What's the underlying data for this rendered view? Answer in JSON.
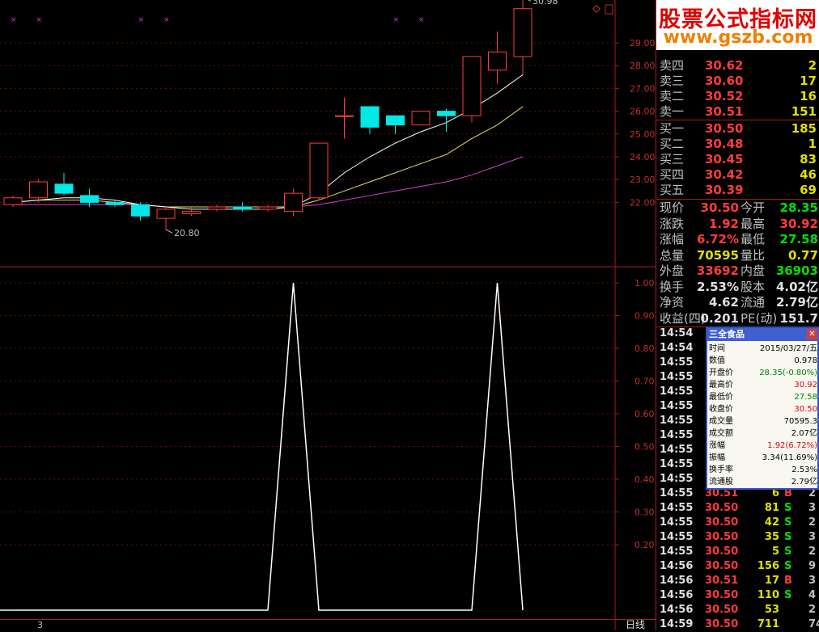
{
  "chart_data": [
    {
      "type": "candlestick",
      "y_ticks": [
        "29.00",
        "28.00",
        "27.00",
        "26.00",
        "25.00",
        "24.00",
        "23.00",
        "22.00"
      ],
      "ylim": [
        21.0,
        31.0
      ],
      "annotations": {
        "high": "30.98",
        "low": "20.80"
      },
      "candles": [
        {
          "o": 21.9,
          "c": 22.2,
          "h": 22.3,
          "l": 21.8
        },
        {
          "o": 22.2,
          "c": 22.9,
          "h": 23.0,
          "l": 22.0
        },
        {
          "o": 22.8,
          "c": 22.4,
          "h": 23.3,
          "l": 22.3
        },
        {
          "o": 22.3,
          "c": 22.0,
          "h": 22.6,
          "l": 21.8
        },
        {
          "o": 22.0,
          "c": 21.9,
          "h": 22.1,
          "l": 21.8
        },
        {
          "o": 21.9,
          "c": 21.4,
          "h": 22.0,
          "l": 21.2
        },
        {
          "o": 21.3,
          "c": 21.7,
          "h": 21.8,
          "l": 20.8
        },
        {
          "o": 21.5,
          "c": 21.6,
          "h": 21.8,
          "l": 21.4
        },
        {
          "o": 21.7,
          "c": 21.8,
          "h": 21.9,
          "l": 21.6
        },
        {
          "o": 21.8,
          "c": 21.7,
          "h": 22.0,
          "l": 21.6
        },
        {
          "o": 21.7,
          "c": 21.8,
          "h": 21.9,
          "l": 21.6
        },
        {
          "o": 21.6,
          "c": 22.4,
          "h": 22.6,
          "l": 21.4
        },
        {
          "o": 22.2,
          "c": 24.6,
          "h": 24.6,
          "l": 22.1
        },
        {
          "o": 25.8,
          "c": 25.8,
          "h": 26.6,
          "l": 24.8
        },
        {
          "o": 26.2,
          "c": 25.3,
          "h": 26.2,
          "l": 25.0
        },
        {
          "o": 25.8,
          "c": 25.4,
          "h": 25.8,
          "l": 25.0
        },
        {
          "o": 25.4,
          "c": 26.0,
          "h": 26.0,
          "l": 25.4
        },
        {
          "o": 26.0,
          "c": 25.8,
          "h": 26.1,
          "l": 25.1
        },
        {
          "o": 25.8,
          "c": 28.4,
          "h": 28.4,
          "l": 25.5
        },
        {
          "o": 27.8,
          "c": 28.6,
          "h": 29.5,
          "l": 27.2
        },
        {
          "o": 28.4,
          "c": 30.5,
          "h": 30.98,
          "l": 27.6
        }
      ],
      "ma_fast": [
        22.0,
        22.1,
        22.2,
        22.2,
        22.1,
        21.9,
        21.8,
        21.7,
        21.7,
        21.7,
        21.7,
        21.8,
        22.4,
        23.3,
        24.0,
        24.6,
        25.1,
        25.5,
        26.1,
        26.8,
        27.6
      ],
      "ma_mid": [
        22.0,
        22.1,
        22.1,
        22.1,
        22.0,
        21.9,
        21.8,
        21.8,
        21.8,
        21.8,
        21.8,
        21.8,
        22.1,
        22.5,
        22.9,
        23.3,
        23.7,
        24.1,
        24.8,
        25.4,
        26.2
      ],
      "ma_slow": [
        21.9,
        21.9,
        21.9,
        21.9,
        21.9,
        21.9,
        21.8,
        21.8,
        21.8,
        21.8,
        21.8,
        21.8,
        21.9,
        22.1,
        22.3,
        22.5,
        22.7,
        22.9,
        23.2,
        23.6,
        24.0
      ]
    },
    {
      "type": "line",
      "y_ticks": [
        "1.00",
        "0.90",
        "0.80",
        "0.70",
        "0.60",
        "0.50",
        "0.40",
        "0.30",
        "0.20"
      ],
      "ylim": [
        0.0,
        1.0
      ],
      "values": [
        0,
        0,
        0,
        0,
        0,
        0,
        0,
        0,
        0,
        0,
        0,
        1,
        0,
        0,
        0,
        0,
        0,
        0,
        0,
        1,
        0
      ]
    }
  ],
  "quotes": {
    "asks": [
      {
        "label": "卖四",
        "price": "30.62",
        "vol": "2"
      },
      {
        "label": "卖三",
        "price": "30.60",
        "vol": "17"
      },
      {
        "label": "卖二",
        "price": "30.52",
        "vol": "16"
      },
      {
        "label": "卖一",
        "price": "30.51",
        "vol": "151"
      }
    ],
    "bids": [
      {
        "label": "买一",
        "price": "30.50",
        "vol": "185"
      },
      {
        "label": "买二",
        "price": "30.48",
        "vol": "1"
      },
      {
        "label": "买三",
        "price": "30.45",
        "vol": "83"
      },
      {
        "label": "买四",
        "price": "30.42",
        "vol": "46"
      },
      {
        "label": "买五",
        "price": "30.39",
        "vol": "69"
      }
    ]
  },
  "stats": [
    {
      "l1": "现价",
      "v1": "30.50",
      "l2": "今开",
      "v2": "28.35"
    },
    {
      "l1": "涨跌",
      "v1": "1.92",
      "l2": "最高",
      "v2": "30.92"
    },
    {
      "l1": "涨幅",
      "v1": "6.72%",
      "l2": "最低",
      "v2": "27.58"
    },
    {
      "l1": "总量",
      "v1": "70595",
      "l2": "量比",
      "v2": "0.77"
    },
    {
      "l1": "外盘",
      "v1": "33692",
      "l2": "内盘",
      "v2": "36903"
    },
    {
      "l1": "换手",
      "v1": "2.53%",
      "l2": "股本",
      "v2": "4.02亿"
    },
    {
      "l1": "净资",
      "v1": "4.62",
      "l2": "流通",
      "v2": "2.79亿"
    },
    {
      "l1": "收益(四)",
      "v1": "0.201",
      "l2": "PE(动)",
      "v2": "151.7"
    }
  ],
  "ticks": [
    {
      "time": "14:54",
      "price": "",
      "vol": "",
      "bs": "",
      "n": ""
    },
    {
      "time": "14:54",
      "price": "",
      "vol": "",
      "bs": "",
      "n": ""
    },
    {
      "time": "14:55",
      "price": "",
      "vol": "",
      "bs": "",
      "n": ""
    },
    {
      "time": "14:55",
      "price": "",
      "vol": "",
      "bs": "",
      "n": ""
    },
    {
      "time": "14:55",
      "price": "",
      "vol": "",
      "bs": "",
      "n": ""
    },
    {
      "time": "14:55",
      "price": "",
      "vol": "",
      "bs": "",
      "n": ""
    },
    {
      "time": "14:55",
      "price": "",
      "vol": "",
      "bs": "",
      "n": ""
    },
    {
      "time": "14:55",
      "price": "",
      "vol": "",
      "bs": "",
      "n": ""
    },
    {
      "time": "14:55",
      "price": "",
      "vol": "",
      "bs": "",
      "n": ""
    },
    {
      "time": "14:55",
      "price": "",
      "vol": "",
      "bs": "",
      "n": ""
    },
    {
      "time": "14:55",
      "price": "",
      "vol": "",
      "bs": "",
      "n": ""
    },
    {
      "time": "14:55",
      "price": "30.51",
      "vol": "6",
      "bs": "B",
      "n": "2"
    },
    {
      "time": "14:55",
      "price": "30.50",
      "vol": "81",
      "bs": "S",
      "n": "3"
    },
    {
      "time": "14:55",
      "price": "30.50",
      "vol": "42",
      "bs": "S",
      "n": "2"
    },
    {
      "time": "14:55",
      "price": "30.50",
      "vol": "35",
      "bs": "S",
      "n": "3"
    },
    {
      "time": "14:55",
      "price": "30.50",
      "vol": "5",
      "bs": "S",
      "n": "2"
    },
    {
      "time": "14:56",
      "price": "30.50",
      "vol": "156",
      "bs": "S",
      "n": "9"
    },
    {
      "time": "14:56",
      "price": "30.51",
      "vol": "17",
      "bs": "B",
      "n": "3"
    },
    {
      "time": "14:56",
      "price": "30.50",
      "vol": "110",
      "bs": "S",
      "n": "4"
    },
    {
      "time": "14:56",
      "price": "30.50",
      "vol": "53",
      "bs": "",
      "n": "2"
    },
    {
      "time": "14:59",
      "price": "30.50",
      "vol": "711",
      "bs": "",
      "n": "74"
    }
  ],
  "popup": {
    "title": "三全食品",
    "close": "✕",
    "rows": [
      {
        "k": "时间",
        "v": "2015/03/27/五",
        "c": "#000000"
      },
      {
        "k": "数值",
        "v": "0.978",
        "c": "#000000"
      },
      {
        "k": "开盘价",
        "v": "28.35(-0.80%)",
        "c": "#008000"
      },
      {
        "k": "最高价",
        "v": "30.92",
        "c": "#e00000"
      },
      {
        "k": "最低价",
        "v": "27.58",
        "c": "#008000"
      },
      {
        "k": "收盘价",
        "v": "30.50",
        "c": "#e00000"
      },
      {
        "k": "成交量",
        "v": "70595.3",
        "c": "#000000"
      },
      {
        "k": "成交额",
        "v": "2.07亿",
        "c": "#000000"
      },
      {
        "k": "涨幅",
        "v": "1.92(6.72%)",
        "c": "#e00000"
      },
      {
        "k": "振幅",
        "v": "3.34(11.69%)",
        "c": "#000000"
      },
      {
        "k": "换手率",
        "v": "2.53%",
        "c": "#000000"
      },
      {
        "k": "流通股",
        "v": "2.79亿",
        "c": "#000000"
      }
    ]
  },
  "logo": {
    "line1": "股票公式指标网",
    "line2": "www.gszb.com"
  },
  "bottom": {
    "day_label": "日线",
    "marker": "3"
  },
  "colors": {
    "up": "#ff3c3c",
    "down": "#00e8e8",
    "grid": "#a02020",
    "ma_fast": "#ffffff",
    "ma_mid": "#e0e060",
    "ma_slow": "#d040d0"
  }
}
